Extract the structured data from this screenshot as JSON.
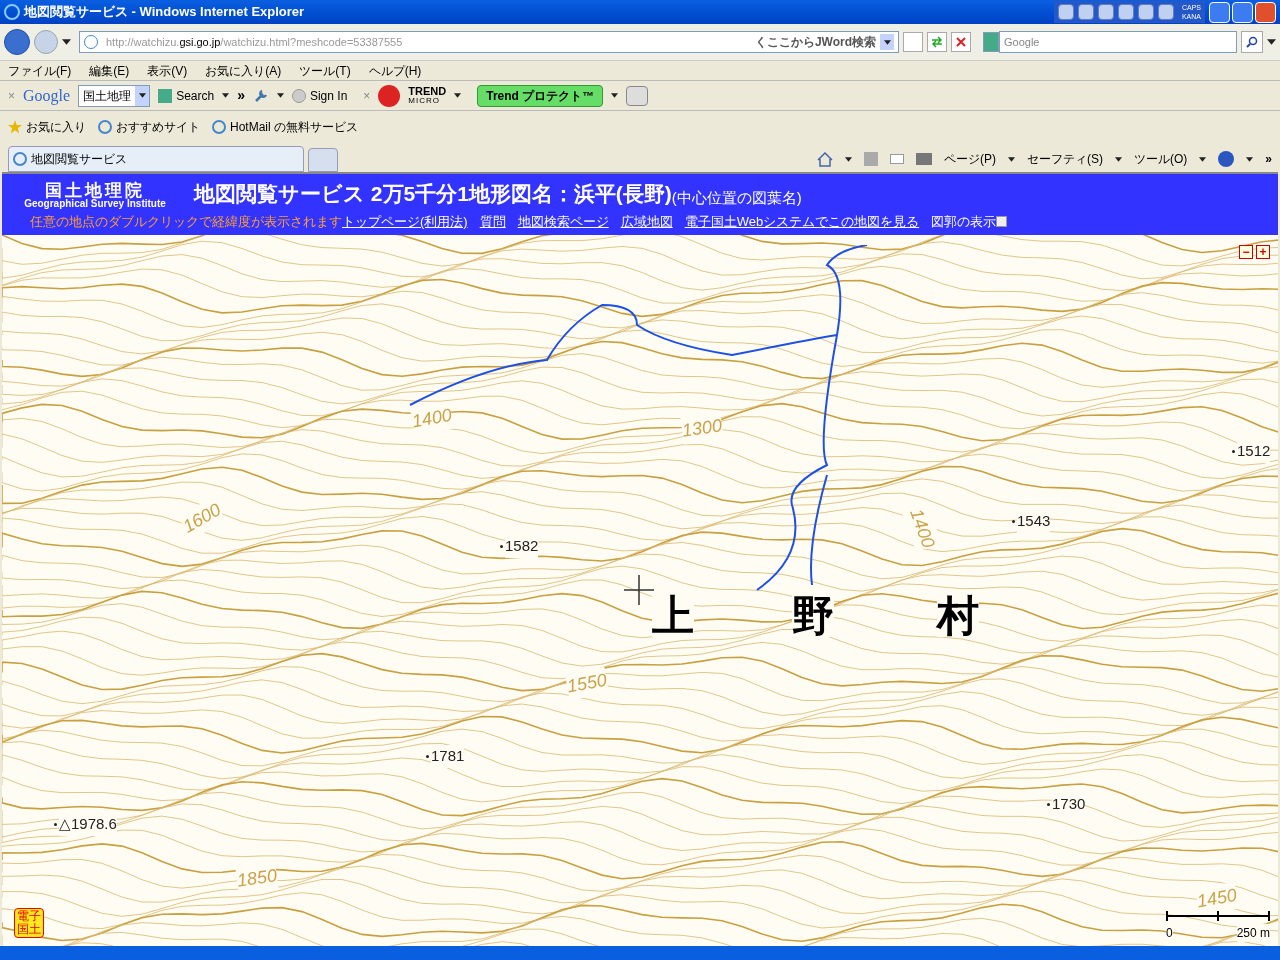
{
  "window": {
    "title": "地図閲覧サービス - Windows Internet Explorer",
    "ime": [
      "CAPS",
      "KANA"
    ]
  },
  "address_bar": {
    "url_host": "http://watchizu.",
    "url_domain": "gsi.go.jp",
    "url_path": "/watchizu.html?meshcode=53387555",
    "jword": "くここからJWord検索",
    "search_placeholder": "Google"
  },
  "menu": [
    "ファイル(F)",
    "編集(E)",
    "表示(V)",
    "お気に入り(A)",
    "ツール(T)",
    "ヘルプ(H)"
  ],
  "toolbar": {
    "close": "×",
    "google": "Google",
    "google_select": "国土地理",
    "search": "Search",
    "more": "»",
    "sign_in": "Sign In",
    "close2": "×",
    "trend": "TREND",
    "trend_sub": "MICRO",
    "protect": "Trend プロテクト™"
  },
  "favorites": [
    "お気に入り",
    "おすすめサイト",
    "HotMail の無料サービス"
  ],
  "tabs": [
    {
      "label": "地図閲覧サービス",
      "selected": true
    },
    {
      "selected": false
    }
  ],
  "commands": [
    "ページ(P)",
    "セーフティ(S)",
    "ツール(O)"
  ],
  "command_more": "»",
  "header": {
    "logo": "国土地理院",
    "logo_en": "Geographical Survey Institute",
    "title": "地図閲覧サービス 2万5千分1地形図名：浜平(長野)",
    "subtitle": "(中心位置の図葉名)",
    "hint": "任意の地点のダブルクリックで経緯度が表示されます",
    "links": [
      "トップページ(利用法)",
      "質問",
      "地図検索ページ",
      "広域地図",
      "電子国土Webシステムでこの地図を見る"
    ],
    "frame_toggle": {
      "label": "図郭の表示",
      "checked": false
    }
  },
  "map": {
    "zoom_out": "−",
    "zoom_in": "+",
    "spot_heights": [
      "1512",
      "1543",
      "1582",
      "1781",
      "1730",
      "△1978.6"
    ],
    "contour_labels": [
      "1400",
      "1300",
      "1600",
      "1400",
      "1550",
      "1850",
      "1450"
    ],
    "place_name": [
      "上",
      "野",
      "村"
    ],
    "badge": "電子国土",
    "scale": {
      "start": "0",
      "end": "250 m"
    }
  }
}
